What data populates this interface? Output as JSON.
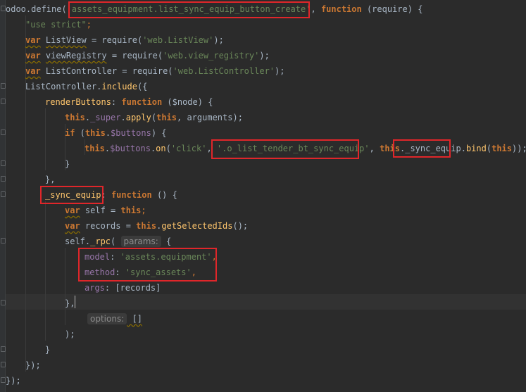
{
  "code": {
    "l1": {
      "a": "odoo.define(",
      "b": "'assets_equipment.list_sync_equip_button_create'",
      "c": ", ",
      "d": "function",
      "e": " (require) {"
    },
    "l2": {
      "a": "\"use strict\"",
      "b": ";"
    },
    "l3": {
      "a": "var",
      "b": " ",
      "c": "ListView",
      "d": " = require(",
      "e": "'web.ListView'",
      "f": ");"
    },
    "l4": {
      "a": "var",
      "b": " ",
      "c": "viewRegistry",
      "d": " = require(",
      "e": "'web.view_registry'",
      "f": ");"
    },
    "l5": {
      "a": "var",
      "b": " ListController = require(",
      "c": "'web.ListController'",
      "d": ");"
    },
    "l6": {
      "a": "ListController.",
      "b": "include",
      "c": "({"
    },
    "l7": {
      "a": "renderButtons",
      "b": ": ",
      "c": "function",
      "d": " ($node) {"
    },
    "l8": {
      "a": "this",
      "b": ".",
      "c": "_super",
      "d": ".",
      "e": "apply",
      "f": "(",
      "g": "this",
      "h": ", arguments);"
    },
    "l9": {
      "a": "if",
      "b": " (",
      "c": "this",
      "d": ".",
      "e": "$buttons",
      "f": ") {"
    },
    "l10": {
      "a": "this",
      "b": ".",
      "c": "$buttons",
      "d": ".",
      "e": "on",
      "f": "(",
      "g": "'click'",
      "h": ", ",
      "i": "'.o_list_tender_bt_sync_equip'",
      "j": ", ",
      "k": "this",
      "l": ".",
      "m": "_sync_equip",
      "n": ".",
      "o": "bind",
      "p": "(",
      "q": "this",
      "r": "));"
    },
    "l11": {
      "a": "}"
    },
    "l12": {
      "a": "},"
    },
    "l13": {
      "a": "_sync_equip",
      "b": ": ",
      "c": "function",
      "d": " () {"
    },
    "l14": {
      "a": "var",
      "b": " self = ",
      "c": "this",
      "d": ";"
    },
    "l15": {
      "a": "var",
      "b": " records = ",
      "c": "this",
      "d": ".",
      "e": "getSelectedIds",
      "f": "();"
    },
    "l16": {
      "a": "self.",
      "b": "_rpc",
      "c": "(",
      "d": "params:",
      "e": " {"
    },
    "l17": {
      "a": "model",
      "b": ": ",
      "c": "'assets.equipment'",
      "d": ","
    },
    "l18": {
      "a": "method",
      "b": ": ",
      "c": "'sync_assets'",
      "d": ","
    },
    "l19": {
      "a": "args",
      "b": ": [records]"
    },
    "l20": {
      "a": "},"
    },
    "l21": {
      "a": "options:",
      "b": " []"
    },
    "l22": {
      "a": ");"
    },
    "l23": {
      "a": "}"
    },
    "l24": {
      "a": "});"
    },
    "l25": {
      "a": "});"
    }
  },
  "colors": {
    "background": "#2b2b2b",
    "keyword": "#cc7832",
    "string": "#6a8759",
    "function_name": "#ffc66d",
    "property": "#9876aa",
    "text": "#a9b7c6",
    "highlight_box": "#e0262a"
  }
}
